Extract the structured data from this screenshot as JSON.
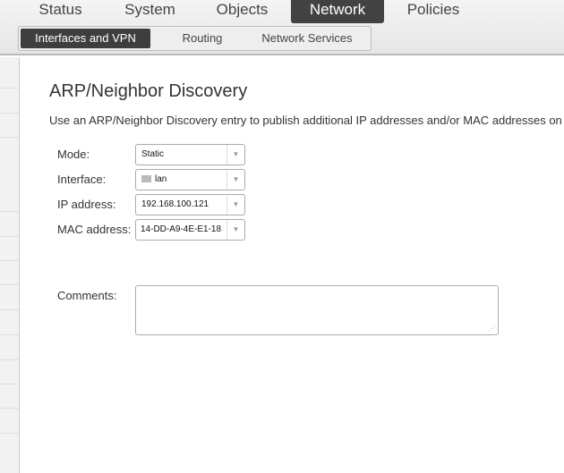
{
  "main_tabs": [
    "Status",
    "System",
    "Objects",
    "Network",
    "Policies"
  ],
  "sub_tabs": [
    "Interfaces and VPN",
    "Routing",
    "Network Services"
  ],
  "page": {
    "title": "ARP/Neighbor Discovery",
    "description": "Use an ARP/Neighbor Discovery entry to publish additional IP addresses and/or MAC addresses on",
    "fields": {
      "mode": {
        "label": "Mode:",
        "value": "Static"
      },
      "interface": {
        "label": "Interface:",
        "value": "lan"
      },
      "ip": {
        "label": "IP address:",
        "value": "192.168.100.121"
      },
      "mac": {
        "label": "MAC address:",
        "value": "14-DD-A9-4E-E1-18"
      },
      "comments": {
        "label": "Comments:",
        "value": ""
      }
    }
  }
}
